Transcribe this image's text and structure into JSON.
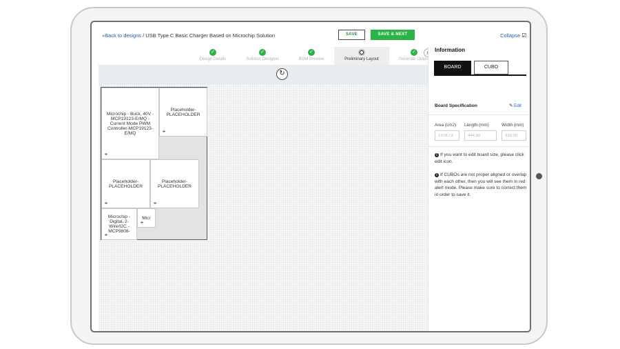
{
  "header": {
    "back_label": "Back to designs",
    "separator": "/",
    "design_title": "USB Type C Basic Charger Based on Microchip Solution",
    "save_label": "SAVE",
    "save_next_label": "SAVE & NEXT",
    "collapse_label": "Collapse"
  },
  "steps": [
    {
      "label": "Design Details",
      "status": "done"
    },
    {
      "label": "Solution Designer",
      "status": "done"
    },
    {
      "label": "BOM Preview",
      "status": "done"
    },
    {
      "label": "Preliminary Layout",
      "status": "current"
    },
    {
      "label": "Generate Output",
      "status": "done"
    }
  ],
  "canvas": {
    "cubos": [
      {
        "text": "Microchip - Buck, 40V - MCP19123-E/MQ - Current Mode PWM Controller-MCP19123-E/MQ"
      },
      {
        "text": "Placeholder-PLACEHOLDER"
      },
      {
        "text": "Placeholder-PLACEHOLDER"
      },
      {
        "text": "Placeholder-PLACEHOLDER"
      },
      {
        "text": "Microchip - Digital, 2-Wire/I2C - MCP9808-"
      },
      {
        "text": "Micr"
      }
    ]
  },
  "panel": {
    "title": "Information",
    "tabs": {
      "board": "BOARD",
      "cubo": "CUBO"
    },
    "spec_title": "Board Specification",
    "edit_label": "Edit",
    "fields": {
      "area": {
        "label": "Area (cm2)",
        "value": "1378.73"
      },
      "length": {
        "label": "Length (mm)",
        "value": "444.68"
      },
      "width": {
        "label": "Width (mm)",
        "value": "310.05"
      }
    },
    "notes": [
      "If you want to edit board size, please click edit icon.",
      "If CUBOs are not proper aligned or overlap with each other, then you will see them in red alert mode. Please make sure to correct them in order to save it."
    ]
  },
  "colors": {
    "accent_green": "#2bb34a",
    "link_blue": "#1a5ea8",
    "tab_active": "#111111"
  }
}
